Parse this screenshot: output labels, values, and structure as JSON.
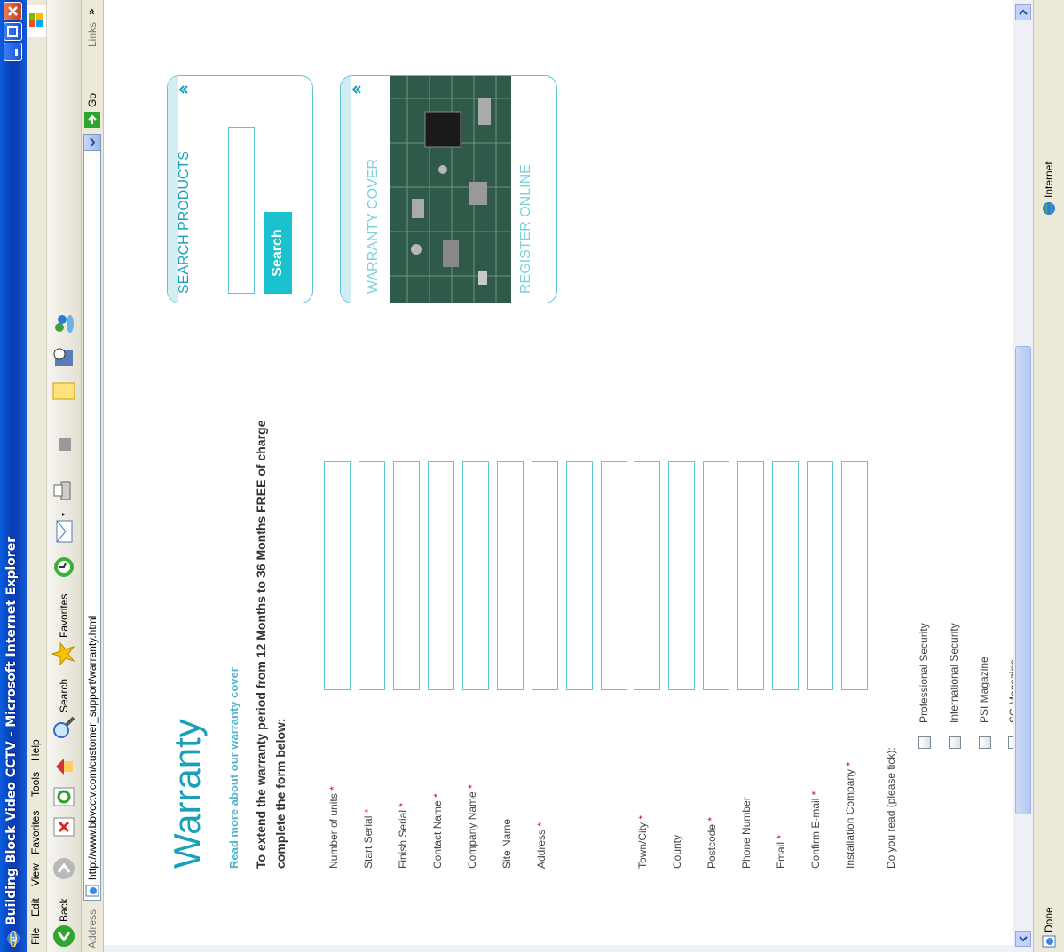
{
  "window": {
    "title": "Building Block Video CCTV - Microsoft Internet Explorer"
  },
  "menu": {
    "items": [
      "File",
      "Edit",
      "View",
      "Favorites",
      "Tools",
      "Help"
    ]
  },
  "toolbar": {
    "back_label": "Back",
    "search_label": "Search",
    "favorites_label": "Favorites"
  },
  "address": {
    "label": "Address",
    "url": "http://www.bbvcctv.com/customer_support/warranty.html",
    "go_label": "Go",
    "links_label": "Links"
  },
  "status": {
    "text": "Done",
    "zone": "Internet"
  },
  "page": {
    "title": "Warranty",
    "read_more": "Read more about our warranty cover",
    "intro": "To extend the warranty period from 12 Months to 36 Months FREE of charge complete the form below:",
    "fields": [
      {
        "label": "Number of units",
        "required": true
      },
      {
        "label": "Start Serial",
        "required": true
      },
      {
        "label": "Finish Serial",
        "required": true
      },
      {
        "label": "Contact Name",
        "required": true
      },
      {
        "label": "Company Name",
        "required": true
      },
      {
        "label": "Site Name",
        "required": false
      },
      {
        "label": "Address",
        "required": true
      },
      {
        "label": "",
        "required": false
      },
      {
        "label": "Town/City",
        "required": true
      },
      {
        "label": "County",
        "required": false
      },
      {
        "label": "Postcode",
        "required": true
      },
      {
        "label": "Phone Number",
        "required": false
      },
      {
        "label": "Email",
        "required": true
      },
      {
        "label": "Confirm E-mail",
        "required": true
      },
      {
        "label": "Installation Company",
        "required": true
      }
    ],
    "required_marker": "*",
    "tick_prompt": "Do you read (please tick):",
    "magazines": [
      "Professional Security",
      "International Security",
      "PSI Magazine",
      "SC Magazine"
    ]
  },
  "sidebar": {
    "search_title": "SEARCH PRODUCTS",
    "search_button": "Search",
    "warranty_title": "WARRANTY COVER",
    "register_title": "REGISTER ONLINE"
  },
  "colors": {
    "accent": "#1aa0b8",
    "button": "#19c2cc",
    "border": "#5bc6d3",
    "required": "#e0101a"
  }
}
